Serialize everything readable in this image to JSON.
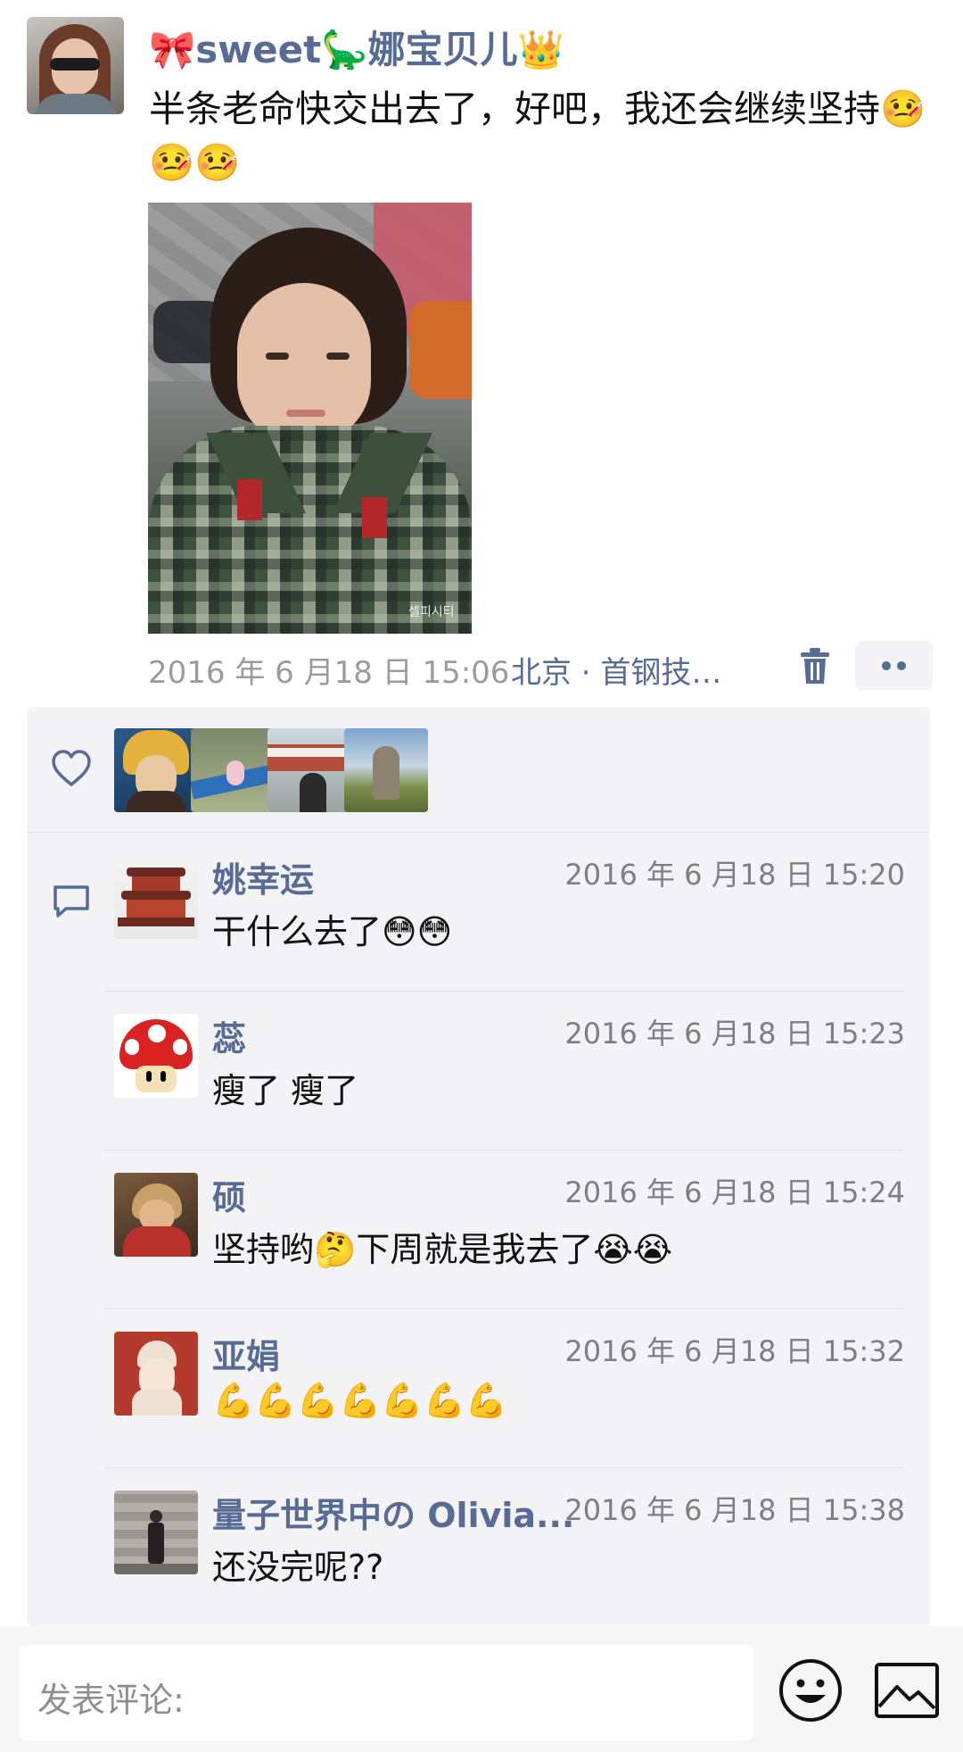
{
  "post": {
    "author": {
      "name_prefix": "🎀",
      "name_part1": "sweet",
      "name_emoji": "🦕",
      "name_part2": "娜宝贝儿",
      "name_suffix": "👑"
    },
    "text": "半条老命快交出去了，好吧，我还会继续坚持🤒🤒🤒",
    "photo": {
      "watermark": "셀피시티"
    },
    "time": "2016 年 6 月18 日  15:06",
    "location": "北京 · 首钢技…"
  },
  "likes": {
    "icon": "heart-icon",
    "avatars": [
      "anime-character",
      "hammock-scene",
      "palace-scene",
      "monument-scene"
    ]
  },
  "comments": [
    {
      "name": "姚幸运",
      "time": "2016 年 6 月18 日  15:20",
      "text": "干什么去了😳😳"
    },
    {
      "name": "蕊",
      "time": "2016 年 6 月18 日  15:23",
      "text": "瘦了 瘦了"
    },
    {
      "name": "硕",
      "time": "2016 年 6 月18 日  15:24",
      "text": "坚持哟🤔下周就是我去了😭😭"
    },
    {
      "name": "亚娟",
      "time": "2016 年 6 月18 日  15:32",
      "text": "💪💪💪💪💪💪💪"
    },
    {
      "name": "量子世界中の Olivia...",
      "time": "2016 年 6 月18 日  15:38",
      "text": "还没完呢??"
    }
  ],
  "bottom_bar": {
    "placeholder": "发表评论:",
    "emoji_icon": "smiley-icon",
    "image_icon": "image-icon"
  },
  "colors": {
    "link": "#576b95",
    "panel": "#f3f3f5",
    "muted": "#9b9b9b"
  }
}
